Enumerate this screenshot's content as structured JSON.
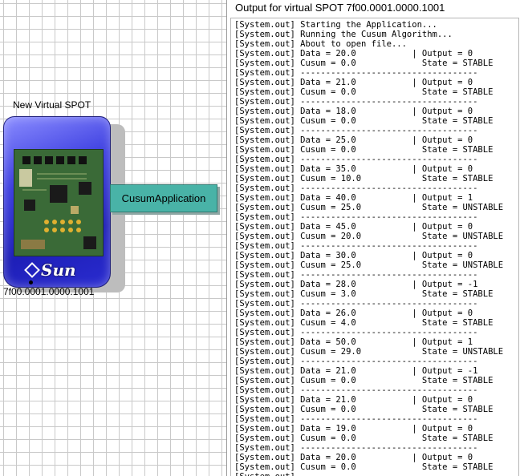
{
  "spot": {
    "title": "New Virtual SPOT",
    "address": "7f00.0001.0000.1001",
    "brand": "Sun"
  },
  "application": {
    "label": "CusumApplication"
  },
  "output_window": {
    "title": "Output for virtual SPOT 7f00.0001.0000.1001",
    "prefix": "[System.out]",
    "header_lines": [
      "Starting the Application...",
      "Running the Cusum Algorithm...",
      "About to open file..."
    ],
    "separator": "-----------------------------------",
    "records": [
      {
        "data": "20.0",
        "output": "0",
        "cusum": "0.0",
        "state": "STABLE"
      },
      {
        "data": "21.0",
        "output": "0",
        "cusum": "0.0",
        "state": "STABLE"
      },
      {
        "data": "18.0",
        "output": "0",
        "cusum": "0.0",
        "state": "STABLE"
      },
      {
        "data": "25.0",
        "output": "0",
        "cusum": "0.0",
        "state": "STABLE"
      },
      {
        "data": "35.0",
        "output": "0",
        "cusum": "10.0",
        "state": "STABLE"
      },
      {
        "data": "40.0",
        "output": "1",
        "cusum": "25.0",
        "state": "UNSTABLE"
      },
      {
        "data": "45.0",
        "output": "0",
        "cusum": "20.0",
        "state": "UNSTABLE"
      },
      {
        "data": "30.0",
        "output": "0",
        "cusum": "25.0",
        "state": "UNSTABLE"
      },
      {
        "data": "28.0",
        "output": "-1",
        "cusum": "3.0",
        "state": "STABLE"
      },
      {
        "data": "26.0",
        "output": "0",
        "cusum": "4.0",
        "state": "STABLE"
      },
      {
        "data": "50.0",
        "output": "1",
        "cusum": "29.0",
        "state": "UNSTABLE"
      },
      {
        "data": "21.0",
        "output": "-1",
        "cusum": "0.0",
        "state": "STABLE"
      },
      {
        "data": "21.0",
        "output": "0",
        "cusum": "0.0",
        "state": "STABLE"
      },
      {
        "data": "19.0",
        "output": "0",
        "cusum": "0.0",
        "state": "STABLE"
      },
      {
        "data": "20.0",
        "output": "0",
        "cusum": "0.0",
        "state": "STABLE"
      }
    ]
  },
  "colors": {
    "app_box": "#49b3a7",
    "spot_body": "#2a2cd0",
    "grid_line": "#c9c9c9"
  }
}
